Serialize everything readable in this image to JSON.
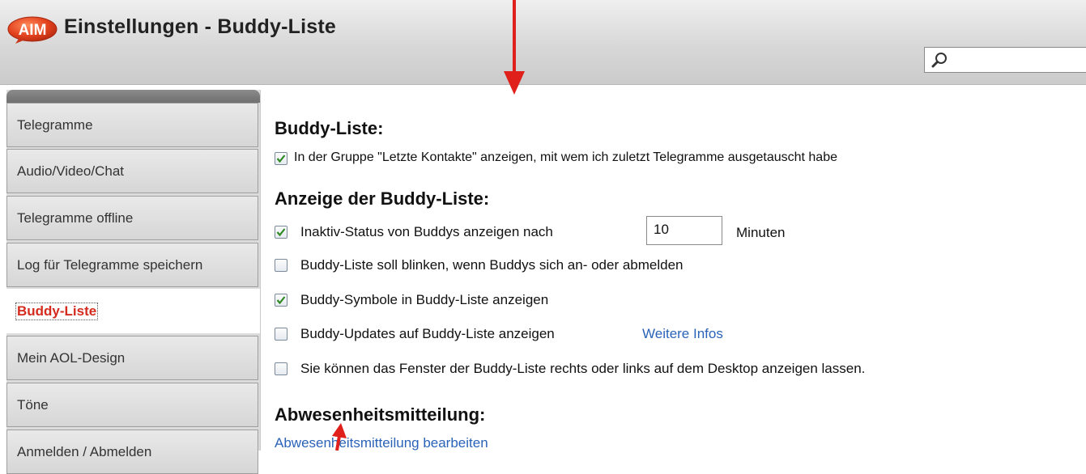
{
  "window": {
    "title": "Einstellungen - Buddy-Liste",
    "logo_text": "AIM",
    "search": {
      "value": "",
      "placeholder": ""
    }
  },
  "sidebar": {
    "items": [
      {
        "label": "Telegramme",
        "active": false
      },
      {
        "label": "Audio/Video/Chat",
        "active": false
      },
      {
        "label": "Telegramme offline",
        "active": false
      },
      {
        "label": "Log für Telegramme speichern",
        "active": false
      },
      {
        "label": "Buddy-Liste",
        "active": true
      },
      {
        "label": "Mein AOL-Design",
        "active": false
      },
      {
        "label": "Töne",
        "active": false
      },
      {
        "label": "Anmelden / Abmelden",
        "active": false
      }
    ]
  },
  "main": {
    "buddy_liste": {
      "heading": "Buddy-Liste:",
      "options": [
        {
          "label": "In der Gruppe \"Letzte Kontakte\" anzeigen, mit wem ich zuletzt Telegramme ausgetauscht habe",
          "checked": true
        }
      ]
    },
    "anzeige": {
      "heading": "Anzeige der Buddy-Liste:",
      "inaktiv": {
        "label": "Inaktiv-Status von Buddys anzeigen nach",
        "checked": true,
        "minutes_value": "10",
        "minutes_unit": "Minuten"
      },
      "blinken": {
        "label": "Buddy-Liste soll blinken, wenn Buddys sich an- oder abmelden",
        "checked": false
      },
      "symbole": {
        "label": "Buddy-Symbole in Buddy-Liste anzeigen",
        "checked": true
      },
      "updates": {
        "label": "Buddy-Updates auf Buddy-Liste anzeigen",
        "checked": false,
        "link": "Weitere Infos"
      },
      "fenster": {
        "label": "Sie können das Fenster der Buddy-Liste rechts oder links auf dem Desktop anzeigen lassen.",
        "checked": false
      }
    },
    "abwesenheit": {
      "heading": "Abwesenheitsmitteilung:",
      "link": "Abwesenheitsmitteilung bearbeiten"
    }
  },
  "colors": {
    "accent_red": "#d42b1e",
    "link_blue": "#2a63b8",
    "annotation_arrow": "#e0211b"
  }
}
